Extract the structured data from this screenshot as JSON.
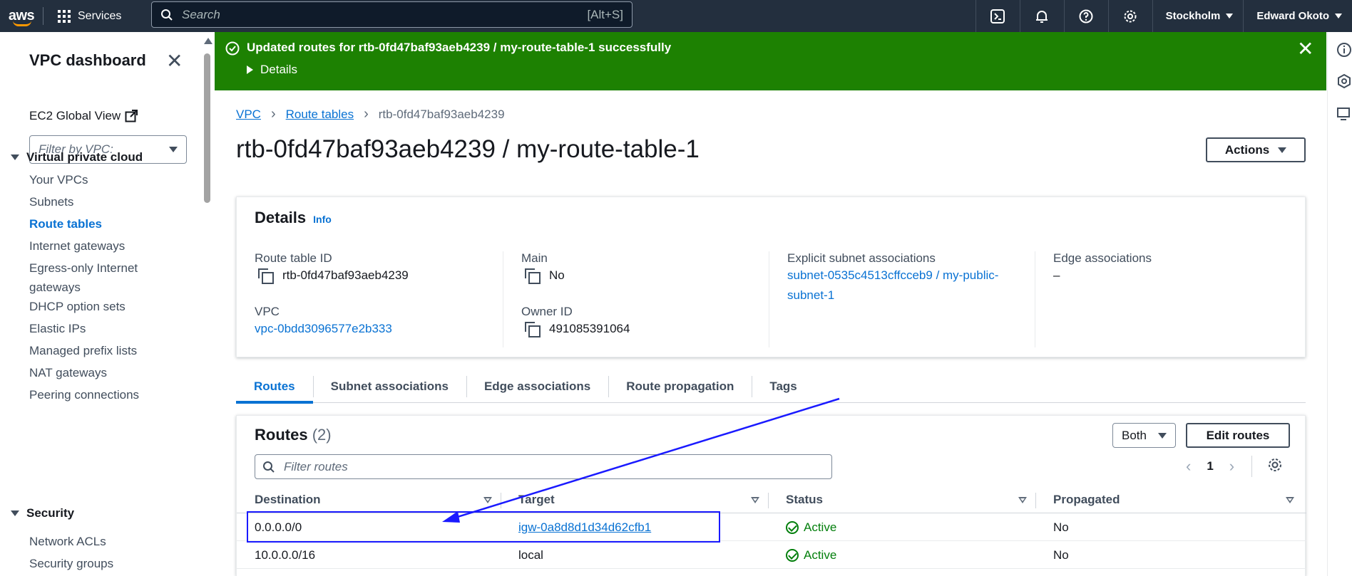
{
  "topnav": {
    "logo": "aws",
    "services_label": "Services",
    "search_placeholder": "Search",
    "search_shortcut": "[Alt+S]",
    "region": "Stockholm",
    "user": "Edward Okoto",
    "icons": [
      "cloudshell-icon",
      "bell-icon",
      "help-icon",
      "settings-icon"
    ]
  },
  "sidebar": {
    "title": "VPC dashboard",
    "ec2_global_view": "EC2 Global View",
    "filter_placeholder": "Filter by VPC:",
    "sections": [
      {
        "label": "Virtual private cloud",
        "items": [
          "Your VPCs",
          "Subnets",
          "Route tables",
          "Internet gateways",
          "Egress-only Internet gateways",
          "DHCP option sets",
          "Elastic IPs",
          "Managed prefix lists",
          "NAT gateways",
          "Peering connections"
        ]
      },
      {
        "label": "Security",
        "items": [
          "Network ACLs",
          "Security groups"
        ]
      }
    ],
    "active_item": "Route tables",
    "egress_line1": "Egress-only Internet",
    "egress_line2": "gateways"
  },
  "flash": {
    "message": "Updated routes for rtb-0fd47baf93aeb4239 / my-route-table-1 successfully",
    "details_label": "Details",
    "color": "#1d8102"
  },
  "breadcrumb": {
    "vpc": "VPC",
    "route_tables": "Route tables",
    "current": "rtb-0fd47baf93aeb4239"
  },
  "page": {
    "title": "rtb-0fd47baf93aeb4239 / my-route-table-1",
    "actions_label": "Actions"
  },
  "details": {
    "heading": "Details",
    "info": "Info",
    "route_table_id_label": "Route table ID",
    "route_table_id": "rtb-0fd47baf93aeb4239",
    "vpc_label": "VPC",
    "vpc": "vpc-0bdd3096577e2b333",
    "main_label": "Main",
    "main": "No",
    "owner_label": "Owner ID",
    "owner": "491085391064",
    "explicit_label": "Explicit subnet associations",
    "explicit_line1": "subnet-0535c4513cffcceb9 / my-public-",
    "explicit_line2": "subnet-1",
    "edge_label": "Edge associations",
    "edge": "–"
  },
  "tabs": [
    "Routes",
    "Subnet associations",
    "Edge associations",
    "Route propagation",
    "Tags"
  ],
  "routes": {
    "heading": "Routes",
    "count": "(2)",
    "both_label": "Both",
    "edit_label": "Edit routes",
    "filter_placeholder": "Filter routes",
    "page": "1",
    "columns": [
      "Destination",
      "Target",
      "Status",
      "Propagated"
    ],
    "rows": [
      {
        "destination": "0.0.0.0/0",
        "target": "igw-0a8d8d1d34d62cfb1",
        "status": "Active",
        "propagated": "No"
      },
      {
        "destination": "10.0.0.0/16",
        "target": "local",
        "status": "Active",
        "propagated": "No"
      }
    ]
  },
  "colors": {
    "accent": "#0972d3",
    "nav_bg": "#232f3e",
    "success": "#037f0c",
    "annotation": "#1a1aff"
  }
}
